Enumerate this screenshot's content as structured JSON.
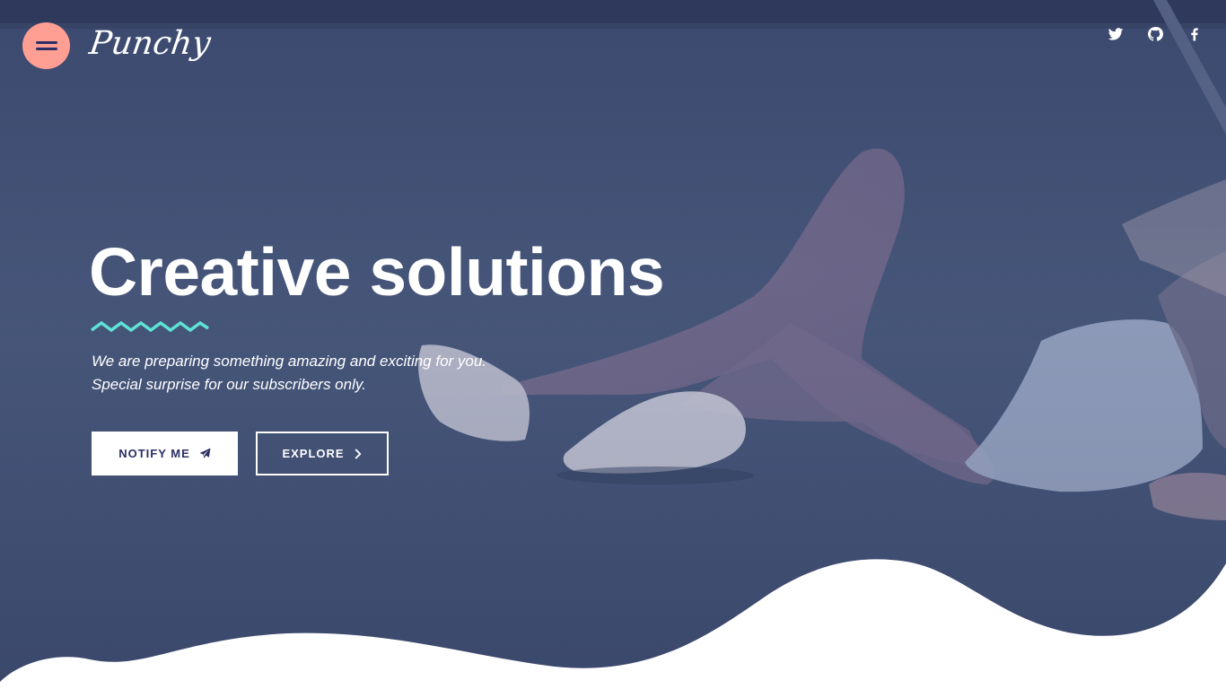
{
  "header": {
    "logo_text": "Punchy",
    "menu_icon": "hamburger-icon"
  },
  "social": [
    {
      "name": "twitter",
      "icon": "twitter-icon"
    },
    {
      "name": "github",
      "icon": "github-icon"
    },
    {
      "name": "facebook",
      "icon": "facebook-icon"
    }
  ],
  "hero": {
    "headline": "Creative solutions",
    "subtitle_line1": "We are preparing something amazing and exciting for you.",
    "subtitle_line2": "Special surprise for our subscribers only.",
    "notify_label": "NOTIFY ME",
    "notify_icon": "paper-plane-icon",
    "explore_label": "EXPLORE",
    "explore_icon": "chevron-right-icon"
  },
  "colors": {
    "overlay": "#435377",
    "menu_button": "#ff9f93",
    "accent_zigzag": "#5ee4d6",
    "dark_text": "#2b2f63",
    "white": "#ffffff"
  }
}
